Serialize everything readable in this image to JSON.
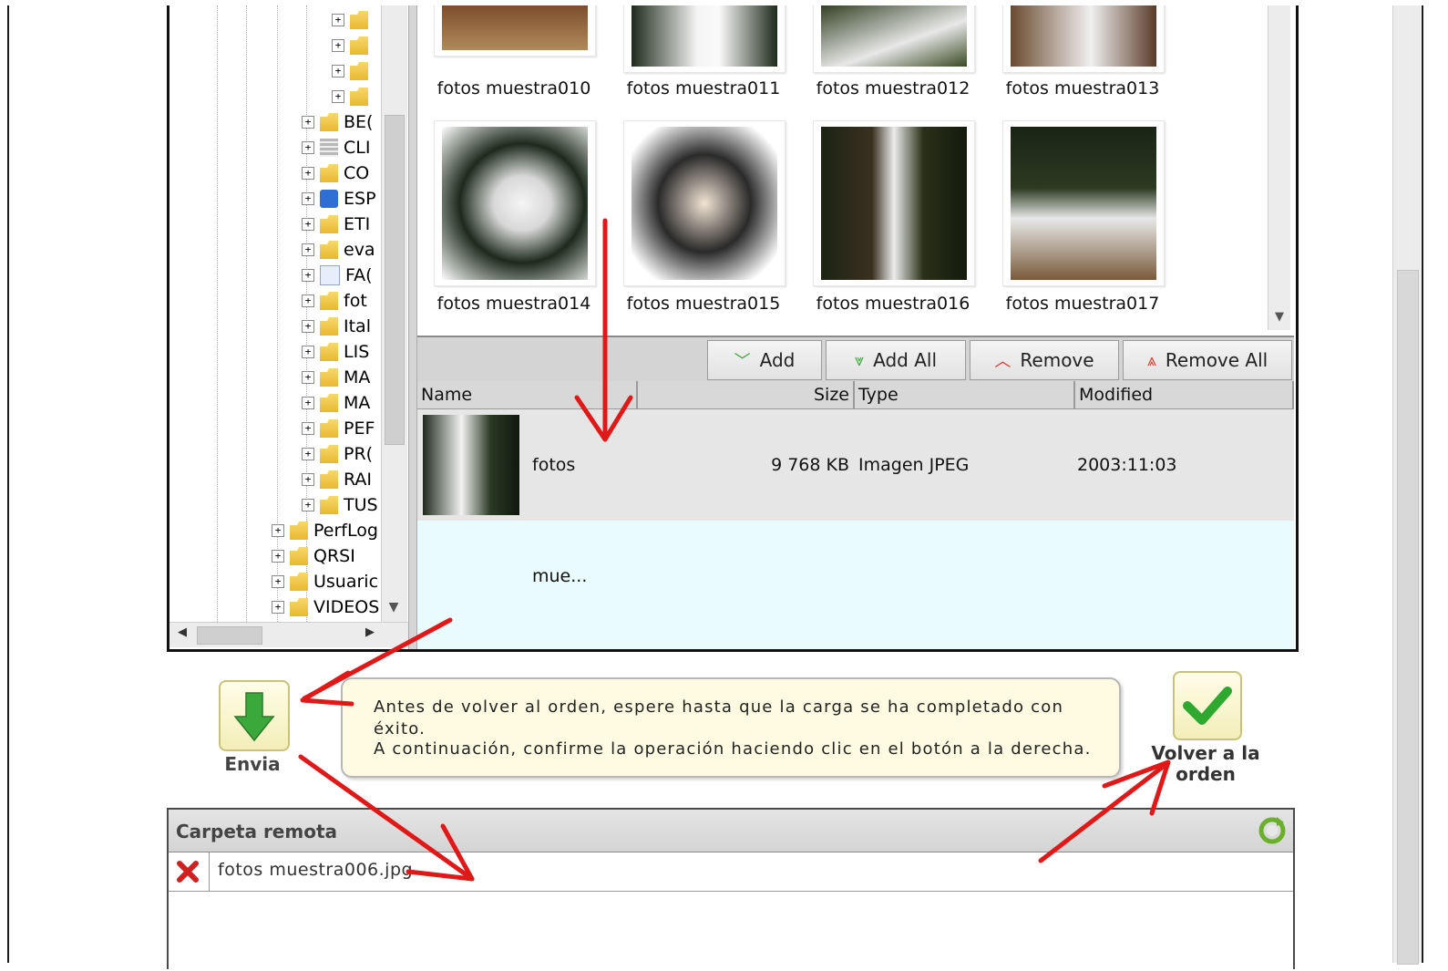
{
  "tree": {
    "items": [
      {
        "label": "",
        "icon": "folder-icon"
      },
      {
        "label": "",
        "icon": "folder-icon"
      },
      {
        "label": "",
        "icon": "folder-icon"
      },
      {
        "label": "",
        "icon": "folder-icon"
      },
      {
        "label": "BE(",
        "icon": "folder-icon"
      },
      {
        "label": "CLI",
        "icon": "database-icon"
      },
      {
        "label": "CO",
        "icon": "folder-icon"
      },
      {
        "label": "ESP",
        "icon": "grid-icon"
      },
      {
        "label": "ETI",
        "icon": "folder-icon"
      },
      {
        "label": "eva",
        "icon": "folder-icon"
      },
      {
        "label": "FA(",
        "icon": "document-icon"
      },
      {
        "label": "fot",
        "icon": "folder-icon"
      },
      {
        "label": "Ital",
        "icon": "folder-icon"
      },
      {
        "label": "LIS",
        "icon": "folder-icon"
      },
      {
        "label": "MA",
        "icon": "folder-icon"
      },
      {
        "label": "MA",
        "icon": "folder-icon"
      },
      {
        "label": "PEF",
        "icon": "folder-icon"
      },
      {
        "label": "PR(",
        "icon": "folder-icon"
      },
      {
        "label": "RAI",
        "icon": "folder-icon"
      },
      {
        "label": "TUS",
        "icon": "folder-icon"
      },
      {
        "label": "PerfLog",
        "icon": "folder-icon"
      },
      {
        "label": "QRSI",
        "icon": "folder-icon"
      },
      {
        "label": "Usuaric",
        "icon": "folder-icon"
      },
      {
        "label": "VIDEOS",
        "icon": "folder-icon"
      }
    ]
  },
  "gallery": {
    "photos": [
      {
        "caption": "fotos muestra010"
      },
      {
        "caption": "fotos muestra011"
      },
      {
        "caption": "fotos muestra012"
      },
      {
        "caption": "fotos muestra013"
      },
      {
        "caption": "fotos muestra014"
      },
      {
        "caption": "fotos muestra015"
      },
      {
        "caption": "fotos muestra016"
      },
      {
        "caption": "fotos muestra017"
      }
    ]
  },
  "toolbar": {
    "add": "Add",
    "add_all": "Add All",
    "remove": "Remove",
    "remove_all": "Remove All"
  },
  "filelist": {
    "columns": {
      "name": "Name",
      "size": "Size",
      "type": "Type",
      "modified": "Modified"
    },
    "rows": [
      {
        "name": "fotos mue...",
        "size": "9 768 KB",
        "type": "Imagen JPEG",
        "modified": "2003:11:03"
      }
    ]
  },
  "upload": {
    "label": "Envia"
  },
  "note": {
    "line1": "Antes de volver al orden, espere hasta que la carga se ha completado con",
    "line2": "éxito.",
    "line3": "A continuación, confirme la operación haciendo clic en el botón a la derecha."
  },
  "back": {
    "label_line1": "Volver a la",
    "label_line2": "orden"
  },
  "remote": {
    "title": "Carpeta remota",
    "files": [
      {
        "name": "fotos muestra006.jpg"
      }
    ]
  },
  "colors": {
    "arrow": "#e01818",
    "check": "#2fa82f",
    "accent_yellow": "#fffbe2"
  }
}
